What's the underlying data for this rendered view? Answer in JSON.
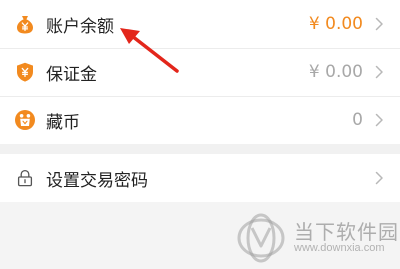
{
  "rows": [
    {
      "label": "账户余额",
      "value": "¥ 0.00",
      "value_color": "#f28a1f",
      "icon": "money-bag-icon"
    },
    {
      "label": "保证金",
      "value": "¥ 0.00",
      "value_color": "#a8a8a8",
      "icon": "shield-yen-icon"
    },
    {
      "label": "藏币",
      "value": "0",
      "value_color": "#a8a8a8",
      "icon": "coin-badge-icon"
    }
  ],
  "settings": {
    "label": "设置交易密码",
    "icon": "lock-icon"
  },
  "watermark": {
    "text": "当下软件园",
    "url": "www.downxia.com"
  },
  "colors": {
    "accent": "#f28a1f",
    "arrow": "#e3261b",
    "background": "#f4f4f4"
  }
}
